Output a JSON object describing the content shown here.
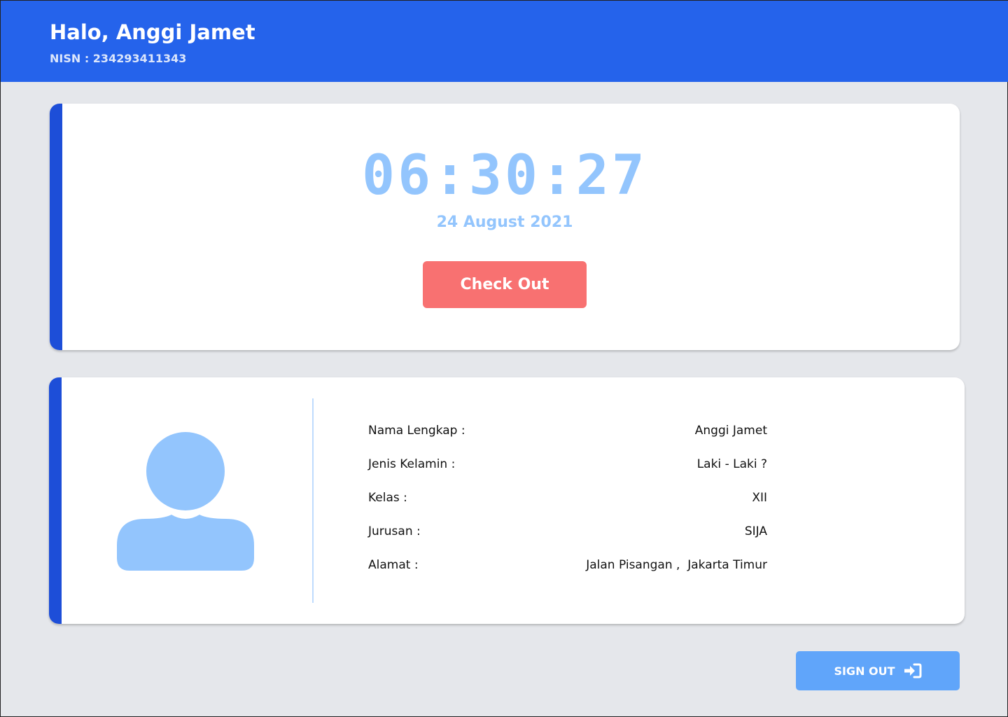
{
  "header": {
    "greeting": "Halo, Anggi Jamet",
    "nisn": "NISN : 234293411343"
  },
  "clock_card": {
    "time": "06:30:27",
    "date": "24 August 2021",
    "checkout_label": "Check Out"
  },
  "profile": {
    "avatar_icon": "user-avatar-icon",
    "rows": [
      {
        "label": "Nama Lengkap :",
        "value": "Anggi Jamet"
      },
      {
        "label": "Jenis Kelamin :",
        "value": "Laki - Laki ?"
      },
      {
        "label": "Kelas :",
        "value": "XII"
      },
      {
        "label": "Jurusan :",
        "value": "SIJA"
      },
      {
        "label": "Alamat :",
        "value": "Jalan Pisangan ,  Jakarta Timur"
      }
    ]
  },
  "signout": {
    "label": "SIGN OUT",
    "icon": "sign-in-arrow-icon"
  },
  "colors": {
    "header_bg": "#2563EB",
    "page_bg": "#E5E7EB",
    "card_accent": "#1D4ED8",
    "clock_text": "#93C5FD",
    "checkout_button": "#F87171",
    "signout_button": "#60A5FA"
  }
}
